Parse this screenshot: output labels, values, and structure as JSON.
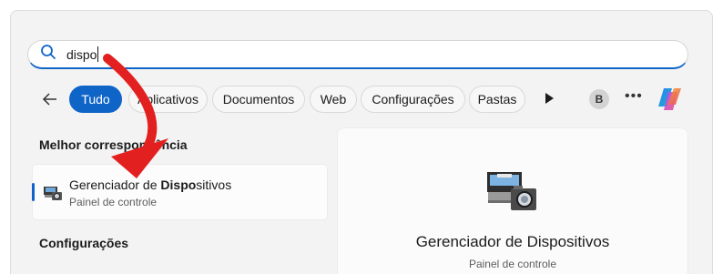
{
  "search": {
    "query": "dispo",
    "icon": "search-icon"
  },
  "filters": {
    "back_icon": "arrow-left-icon",
    "chips": [
      {
        "label": "Tudo",
        "active": true
      },
      {
        "label": "Aplicativos",
        "active": false
      },
      {
        "label": "Documentos",
        "active": false
      },
      {
        "label": "Web",
        "active": false
      },
      {
        "label": "Configurações",
        "active": false
      },
      {
        "label": "Pastas",
        "active": false
      }
    ],
    "more_icon": "play-icon",
    "avatar_letter": "B",
    "overflow": "•••",
    "copilot_icon": "copilot-icon"
  },
  "results": {
    "best_match_heading": "Melhor correspondência",
    "best_match": {
      "name_prefix": "Gerenciador de ",
      "name_highlight": "Dispo",
      "name_suffix": "sitivos",
      "subtitle": "Painel de controle",
      "icon": "device-manager-icon"
    },
    "settings_heading": "Configurações"
  },
  "preview": {
    "title": "Gerenciador de Dispositivos",
    "subtitle": "Painel de controle",
    "icon": "device-manager-icon"
  },
  "colors": {
    "accent": "#0f64c8",
    "annotation_arrow": "#e32020"
  }
}
